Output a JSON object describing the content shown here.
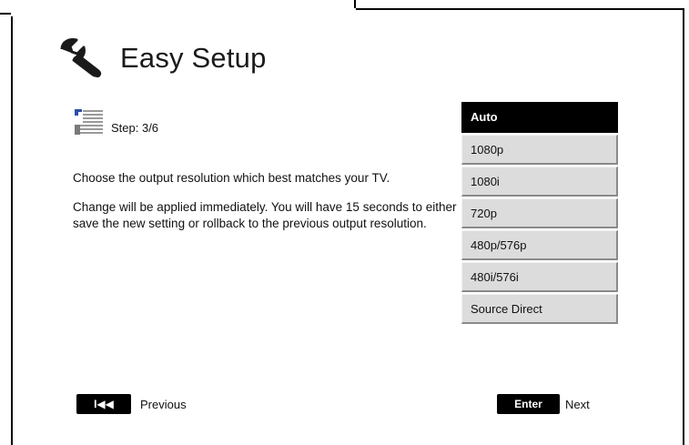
{
  "header": {
    "title": "Easy Setup",
    "icon": "wrench-icon"
  },
  "step": {
    "label": "Step: 3/6",
    "icon": "resolution-grid-icon"
  },
  "description": {
    "line1": "Choose the output resolution which best matches your TV.",
    "line2": "Change will be applied immediately.  You will have 15 seconds to either save the new setting or rollback to the previous output resolution."
  },
  "options": [
    {
      "label": "Auto",
      "selected": true
    },
    {
      "label": "1080p",
      "selected": false
    },
    {
      "label": "1080i",
      "selected": false
    },
    {
      "label": "720p",
      "selected": false
    },
    {
      "label": "480p/576p",
      "selected": false
    },
    {
      "label": "480i/576i",
      "selected": false
    },
    {
      "label": "Source Direct",
      "selected": false
    }
  ],
  "nav": {
    "prev_key": "I◀◀",
    "prev_label": "Previous",
    "next_key": "Enter",
    "next_label": "Next"
  }
}
